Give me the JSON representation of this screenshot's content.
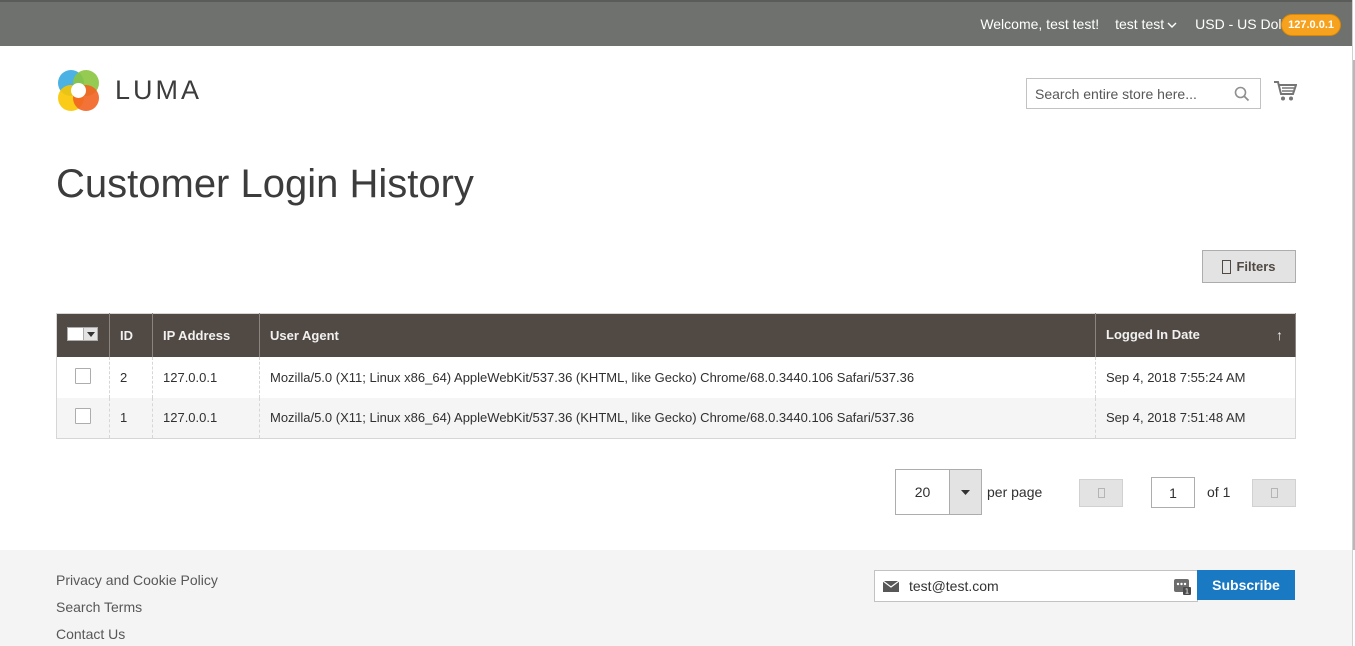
{
  "panel": {
    "welcome": "Welcome, test test!",
    "account_name": "test test",
    "currency": "USD - US Dollar",
    "ip_badge": "127.0.0.1"
  },
  "header": {
    "logo_text": "LUMA",
    "search_placeholder": "Search entire store here..."
  },
  "page": {
    "title": "Customer Login History",
    "filters_label": "Filters"
  },
  "grid": {
    "columns": [
      "ID",
      "IP Address",
      "User Agent",
      "Logged In Date"
    ],
    "sort_indicator": "↑",
    "rows": [
      {
        "id": "2",
        "ip": "127.0.0.1",
        "agent": "Mozilla/5.0 (X11; Linux x86_64) AppleWebKit/537.36 (KHTML, like Gecko) Chrome/68.0.3440.106 Safari/537.36",
        "date": "Sep 4, 2018 7:55:24 AM"
      },
      {
        "id": "1",
        "ip": "127.0.0.1",
        "agent": "Mozilla/5.0 (X11; Linux x86_64) AppleWebKit/537.36 (KHTML, like Gecko) Chrome/68.0.3440.106 Safari/537.36",
        "date": "Sep 4, 2018 7:51:48 AM"
      }
    ]
  },
  "pager": {
    "per_page_value": "20",
    "per_page_label": "per page",
    "current_page": "1",
    "total_label": "of 1"
  },
  "footer": {
    "links": [
      "Privacy and Cookie Policy",
      "Search Terms",
      "Contact Us"
    ],
    "newsletter_value": "test@test.com",
    "subscribe_label": "Subscribe"
  },
  "colors": {
    "panel_bg": "#6e716e",
    "grid_header_bg": "#514943",
    "accent_blue": "#1979c3",
    "badge_orange": "#f6a21e"
  }
}
